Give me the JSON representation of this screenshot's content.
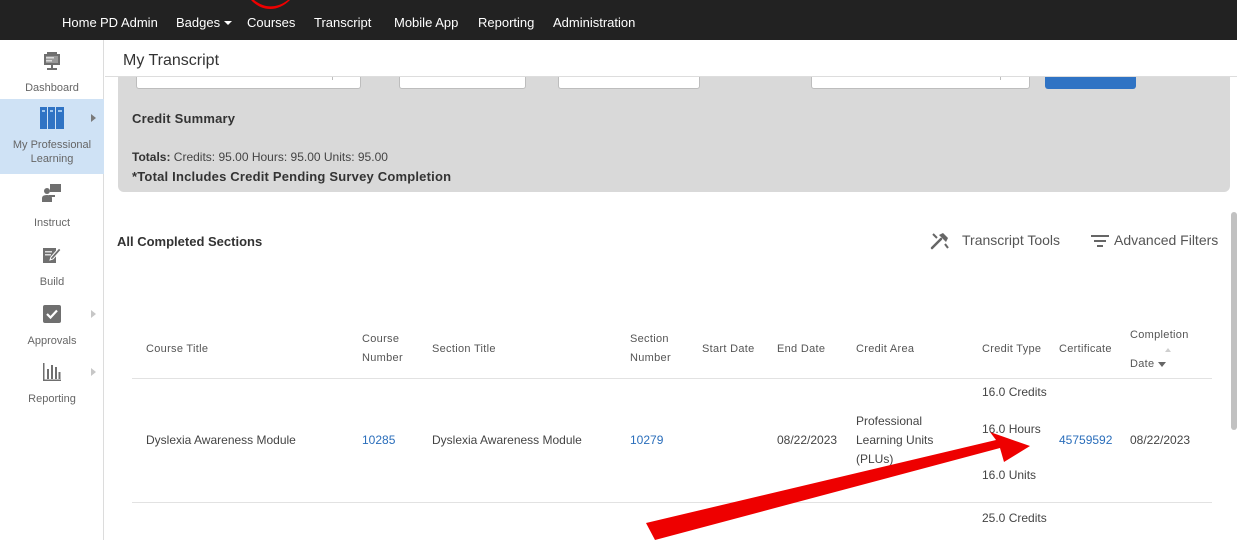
{
  "topnav": {
    "items": [
      "Home",
      "PD Admin",
      "Badges",
      "Courses",
      "Transcript",
      "Mobile App",
      "Reporting",
      "Administration"
    ]
  },
  "sidebar": {
    "items": [
      {
        "label": "Dashboard",
        "icon": "presentation-board-icon"
      },
      {
        "label": "My Professional Learning",
        "icon": "books-icon",
        "active": true
      },
      {
        "label": "Instruct",
        "icon": "teacher-icon"
      },
      {
        "label": "Build",
        "icon": "pencil-edit-icon"
      },
      {
        "label": "Approvals",
        "icon": "checkbox-icon"
      },
      {
        "label": "Reporting",
        "icon": "bar-chart-icon"
      }
    ]
  },
  "header": {
    "title": "My Transcript"
  },
  "credit_summary": {
    "title": "Credit Summary",
    "totals_label": "Totals:",
    "totals_value": "Credits: 95.00   Hours: 95.00   Units: 95.00",
    "note": "*Total Includes Credit Pending Survey Completion"
  },
  "section": {
    "title": "All Completed Sections",
    "tools_label": "Transcript Tools",
    "filters_label": "Advanced Filters"
  },
  "table": {
    "columns": {
      "course_title": "Course Title",
      "course_number_1": "Course",
      "course_number_2": "Number",
      "section_title": "Section Title",
      "section_number_1": "Section",
      "section_number_2": "Number",
      "start_date": "Start Date",
      "end_date": "End Date",
      "credit_area": "Credit Area",
      "credit_type": "Credit Type",
      "certificate": "Certificate",
      "completion_1": "Completion",
      "completion_2": "Date"
    },
    "rows": [
      {
        "course_title": "Dyslexia Awareness Module",
        "course_number": "10285",
        "section_title": "Dyslexia Awareness Module",
        "section_number": "10279",
        "start_date": "",
        "end_date": "08/22/2023",
        "credit_area_1": "Professional",
        "credit_area_2": "Learning Units",
        "credit_area_3": "(PLUs)",
        "credit_credits": "16.0 Credits",
        "credit_hours": "16.0 Hours",
        "credit_units": "16.0 Units",
        "certificate": "45759592",
        "completion_date": "08/22/2023"
      },
      {
        "credit_credits": "25.0 Credits"
      }
    ]
  },
  "colors": {
    "nav_bg": "#222222",
    "sidebar_active": "#cfe2f5",
    "summary_bg": "#d9d9d9",
    "link": "#2a6ebb",
    "annotation": "#ee0000"
  }
}
